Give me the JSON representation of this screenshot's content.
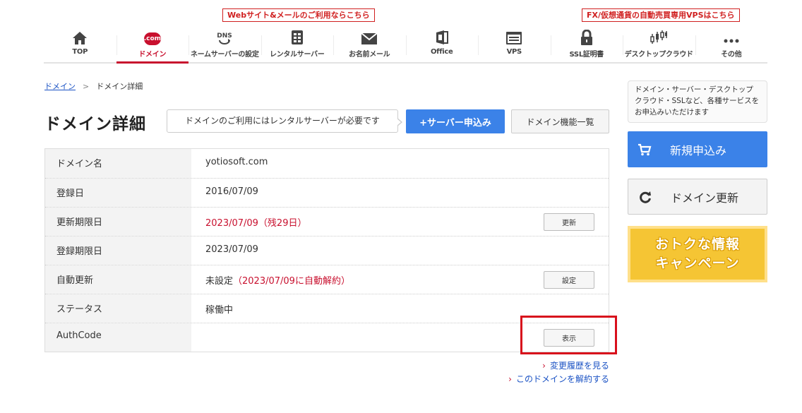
{
  "promos": {
    "web_mail": "Webサイト&メールのご利用ならこちら",
    "fx_vps": "FX/仮想通貨の自動売買専用VPSはこちら"
  },
  "nav": {
    "items": [
      {
        "label": "TOP",
        "icon": "home-icon"
      },
      {
        "label": "ドメイン",
        "icon": "dotcom-icon",
        "icon_text": ".com",
        "active": true
      },
      {
        "label": "ネームサーバーの設定",
        "icon": "dns-icon",
        "icon_text": "DNS"
      },
      {
        "label": "レンタルサーバー",
        "icon": "server-icon"
      },
      {
        "label": "お名前メール",
        "icon": "mail-icon"
      },
      {
        "label": "Office",
        "icon": "office-icon"
      },
      {
        "label": "VPS",
        "icon": "vps-icon"
      },
      {
        "label": "SSL証明書",
        "icon": "lock-icon"
      },
      {
        "label": "デスクトップクラウド",
        "icon": "chart-icon"
      },
      {
        "label": "その他",
        "icon": "more-icon"
      }
    ]
  },
  "breadcrumb": {
    "root": "ドメイン",
    "separator": ">",
    "current": "ドメイン詳細"
  },
  "page": {
    "title": "ドメイン詳細",
    "notice": "ドメインのご利用にはレンタルサーバーが必要です",
    "apply_button": "サーバー申込み",
    "apply_button_icon": "+",
    "feature_list_button": "ドメイン機能一覧"
  },
  "detail": {
    "domain_name_label": "ドメイン名",
    "domain_name": "yotiosoft.com",
    "registered_label": "登録日",
    "registered": "2016/07/09",
    "renewal_deadline_label": "更新期限日",
    "renewal_deadline": "2023/07/09（残29日）",
    "renew_button": "更新",
    "registration_deadline_label": "登録期限日",
    "registration_deadline": "2023/07/09",
    "auto_renew_label": "自動更新",
    "auto_renew_prefix": "未設定",
    "auto_renew_note": "（2023/07/09に自動解約）",
    "settings_button": "設定",
    "status_label": "ステータス",
    "status": "稼働中",
    "authcode_label": "AuthCode",
    "show_button": "表示"
  },
  "links": {
    "history": "変更履歴を見る",
    "cancel": "このドメインを解約する",
    "caret": "›"
  },
  "side": {
    "note": "ドメイン・サーバー・デスクトップクラウド・SSLなど、各種サービスをお申込みいただけます",
    "new_order": "新規申込み",
    "renew": "ドメイン更新",
    "banner_line1": "おトクな情報",
    "banner_line2": "キャンペーン"
  },
  "colors": {
    "brand_red": "#c8102e",
    "primary_blue": "#3b82e8",
    "highlight_red": "#d8101c",
    "banner_yellow": "#f5c534"
  }
}
